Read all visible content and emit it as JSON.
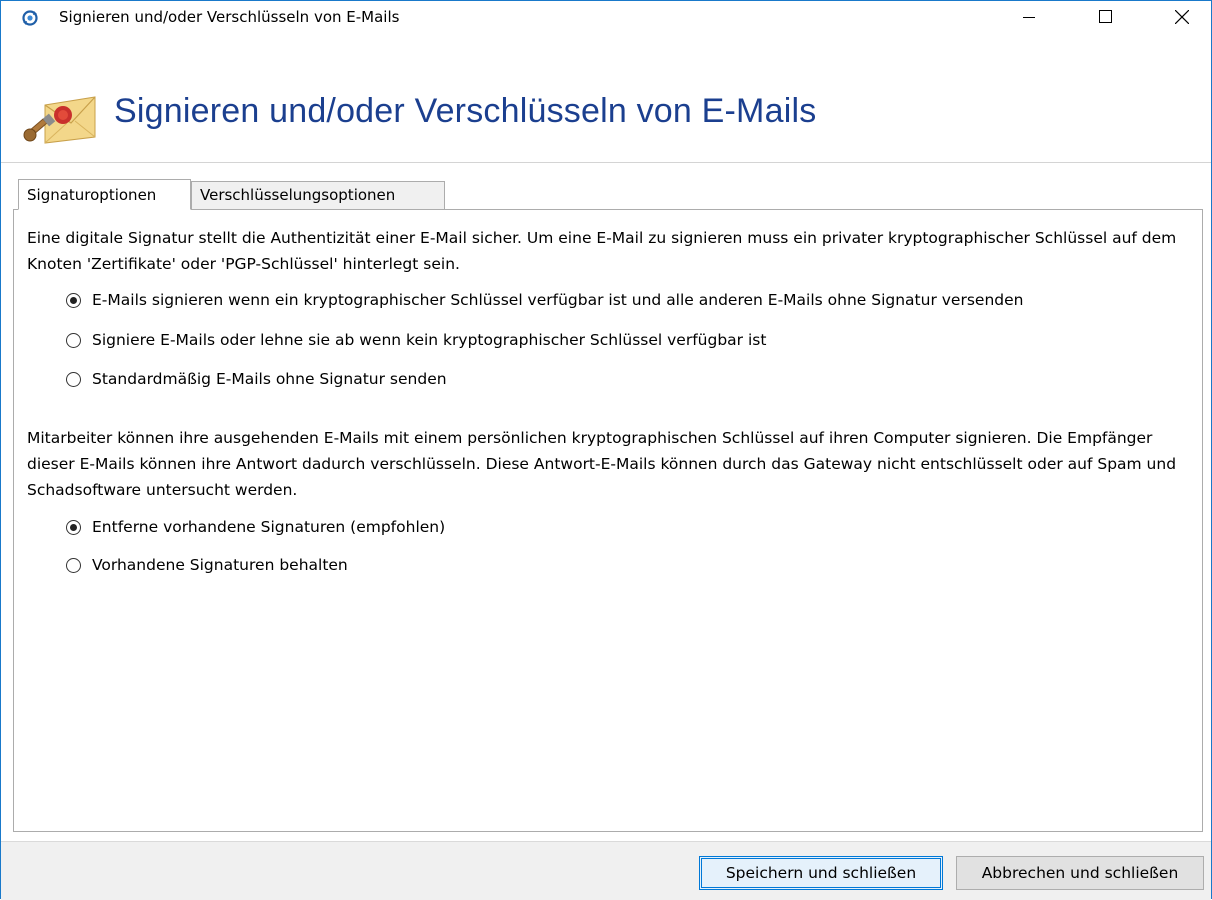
{
  "window": {
    "title": "Signieren und/oder Verschlüsseln von E-Mails",
    "accent_color": "#1979ca"
  },
  "header": {
    "title": "Signieren und/oder Verschlüsseln von E-Mails",
    "title_color": "#1b3f8f",
    "icon": "sealed-envelope-icon"
  },
  "tabs": [
    {
      "label": "Signaturoptionen",
      "selected": true
    },
    {
      "label": "Verschlüsselungsoptionen",
      "selected": false
    }
  ],
  "signature": {
    "description": "Eine digitale Signatur stellt die Authentizität einer E-Mail sicher. Um eine E-Mail zu signieren muss ein privater kryptographischer Schlüssel auf dem Knoten 'Zertifikate' oder 'PGP-Schlüssel' hinterlegt sein.",
    "options": [
      {
        "label": "E-Mails signieren wenn ein kryptographischer Schlüssel verfügbar ist und alle anderen E-Mails ohne Signatur versenden",
        "checked": true
      },
      {
        "label": "Signiere E-Mails oder lehne sie ab wenn kein kryptographischer Schlüssel verfügbar ist",
        "checked": false
      },
      {
        "label": "Standardmäßig E-Mails ohne Signatur senden",
        "checked": false
      }
    ]
  },
  "existing_signatures": {
    "description": "Mitarbeiter können ihre ausgehenden E-Mails mit einem persönlichen kryptographischen Schlüssel auf ihren Computer signieren. Die Empfänger dieser E-Mails können ihre Antwort dadurch verschlüsseln. Diese Antwort-E-Mails können durch das Gateway nicht entschlüsselt oder auf Spam und Schadsoftware untersucht werden.",
    "options": [
      {
        "label": "Entferne vorhandene Signaturen (empfohlen)",
        "checked": true
      },
      {
        "label": "Vorhandene Signaturen behalten",
        "checked": false
      }
    ]
  },
  "footer": {
    "save_label": "Speichern und schließen",
    "cancel_label": "Abbrechen und schließen"
  }
}
